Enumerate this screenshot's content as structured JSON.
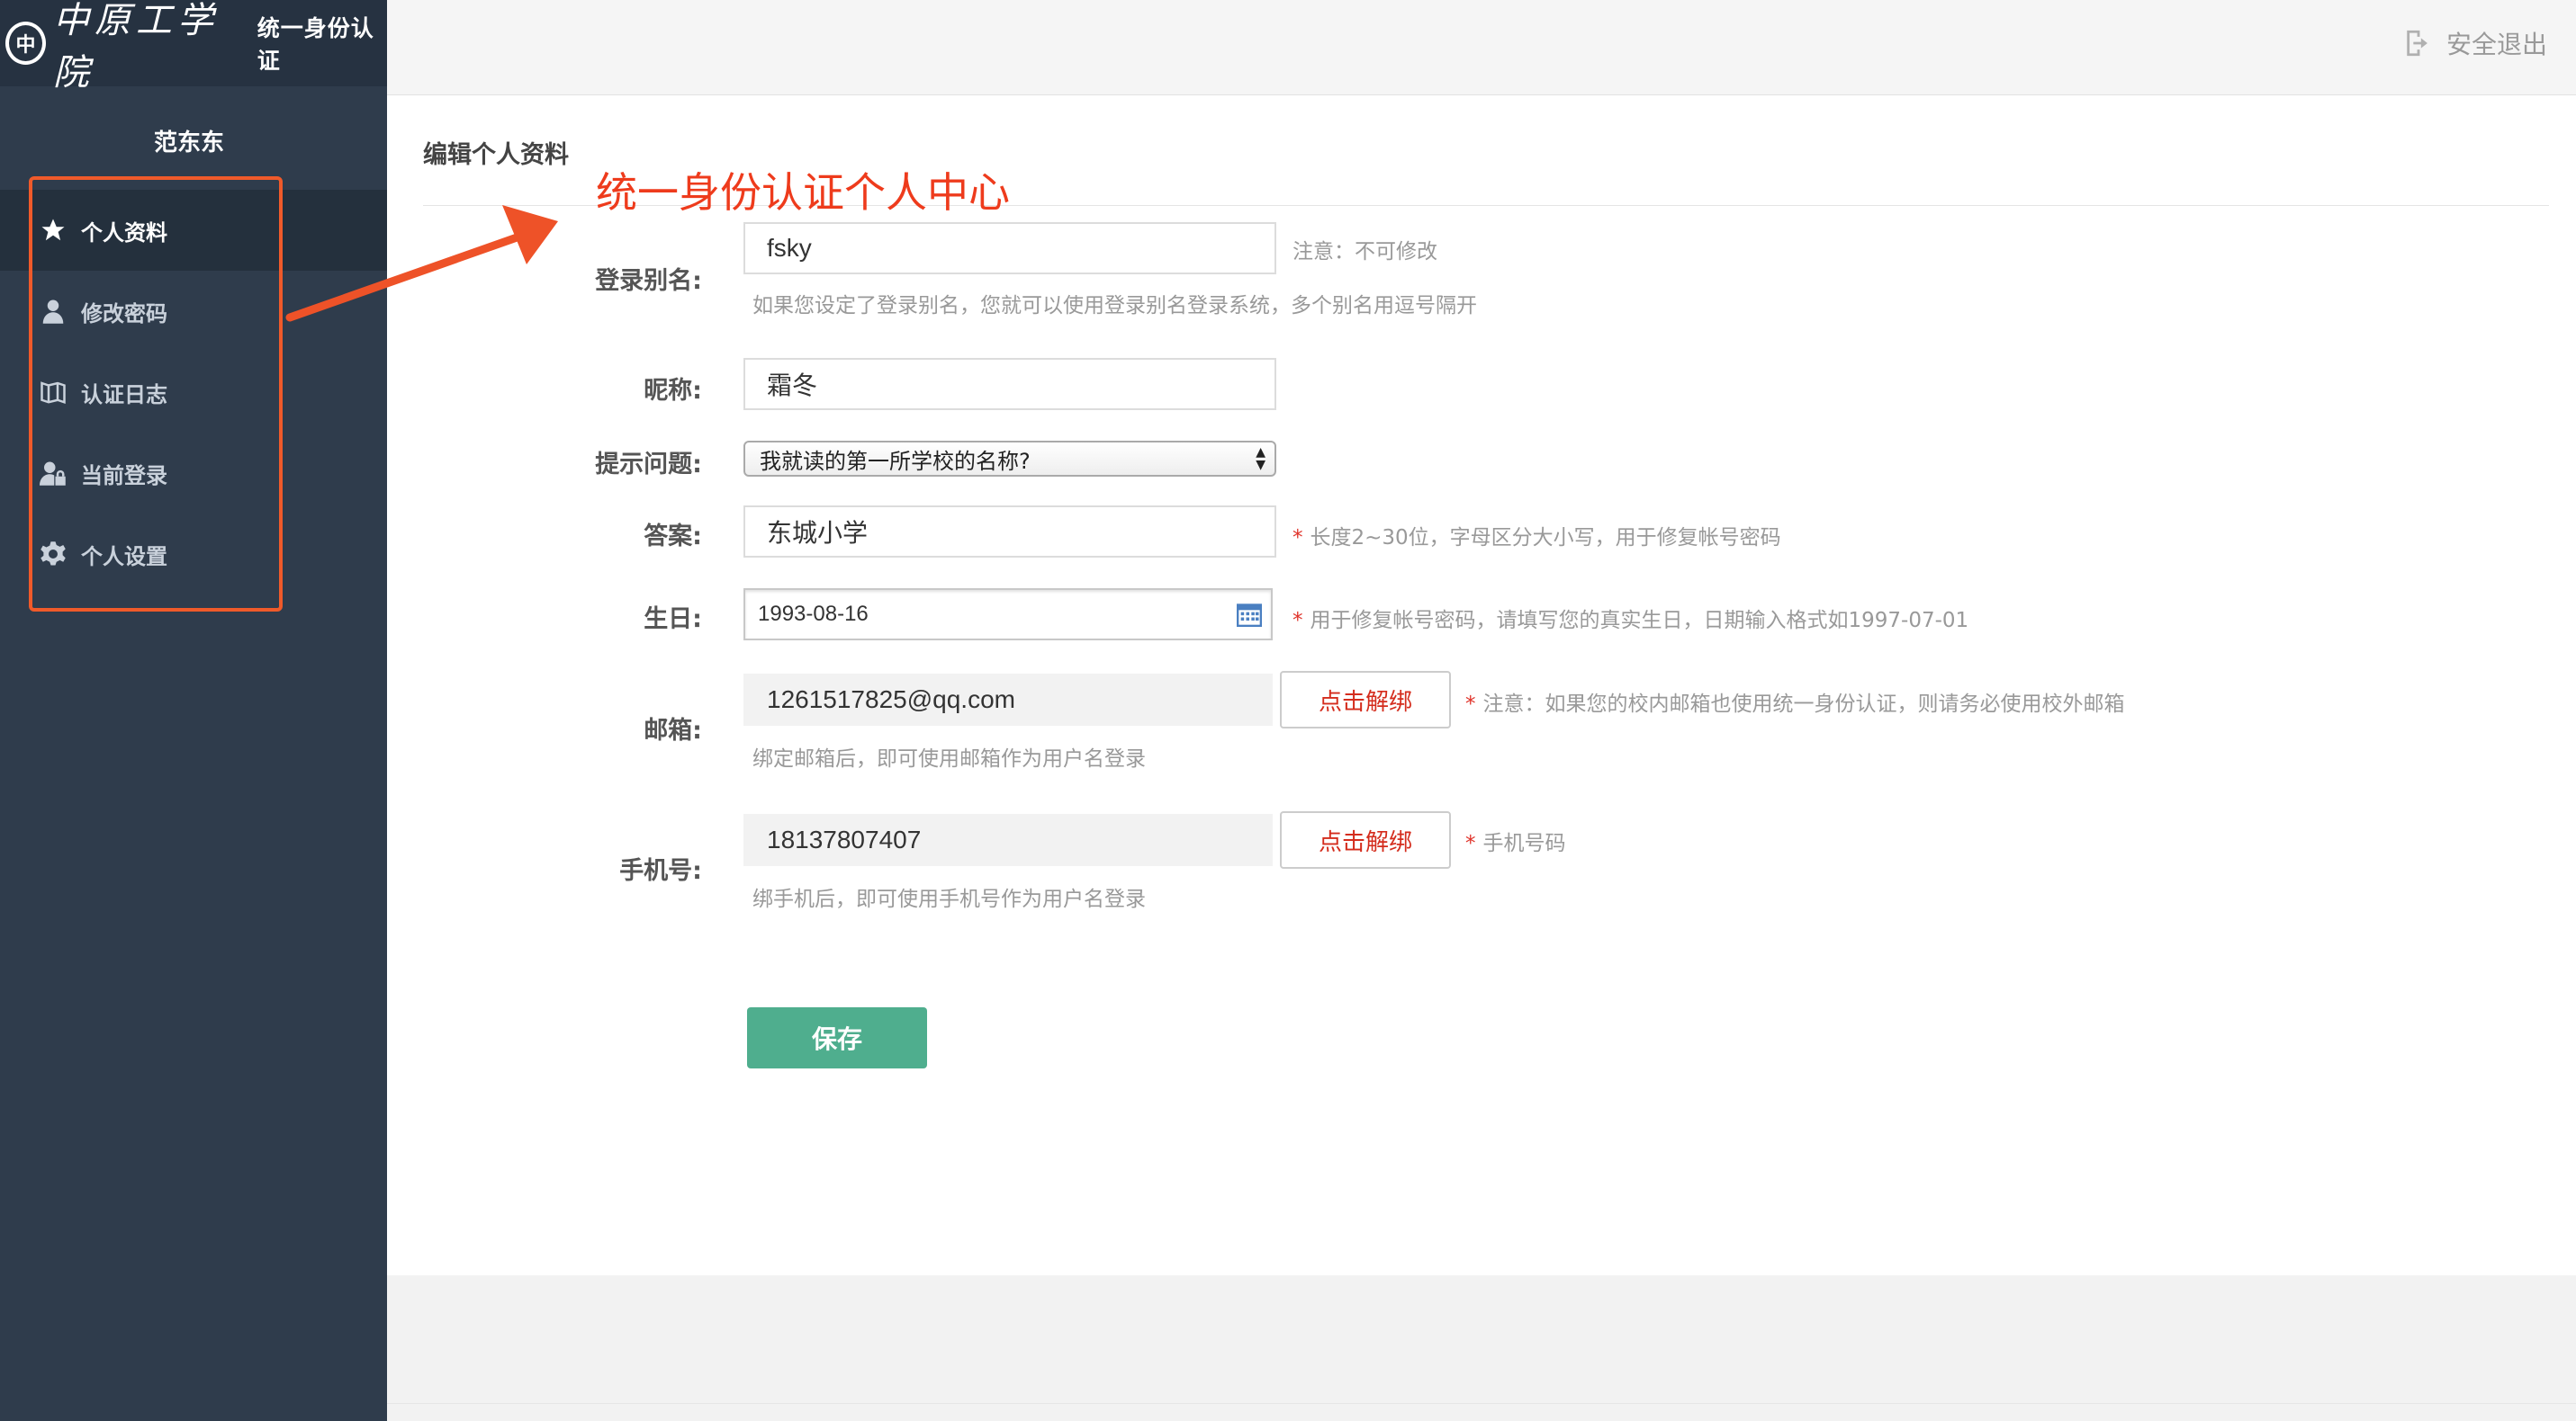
{
  "brand": {
    "logo_script": "中原工学院",
    "subtitle": "统一身份认证",
    "seal_char": "中"
  },
  "header": {
    "logout_label": "安全退出",
    "logout_icon": "logout-icon"
  },
  "sidebar": {
    "user_name": "范东东",
    "items": [
      {
        "label": "个人资料",
        "icon": "star-icon",
        "active": true
      },
      {
        "label": "修改密码",
        "icon": "user-icon",
        "active": false
      },
      {
        "label": "认证日志",
        "icon": "book-icon",
        "active": false
      },
      {
        "label": "当前登录",
        "icon": "user-lock-icon",
        "active": false
      },
      {
        "label": "个人设置",
        "icon": "gear-icon",
        "active": false
      }
    ]
  },
  "main": {
    "section_title": "编辑个人资料",
    "annotation": "统一身份认证个人中心",
    "form": {
      "alias": {
        "label": "登录别名:",
        "value": "fsky",
        "note": "注意：不可修改",
        "help": "如果您设定了登录别名，您就可以使用登录别名登录系统，多个别名用逗号隔开"
      },
      "nickname": {
        "label": "昵称:",
        "value": "霜冬"
      },
      "question": {
        "label": "提示问题:",
        "value": "我就读的第一所学校的名称?"
      },
      "answer": {
        "label": "答案:",
        "value": "东城小学",
        "note": "长度2~30位，字母区分大小写，用于修复帐号密码"
      },
      "birthday": {
        "label": "生日:",
        "value": "1993-08-16",
        "note": "用于修复帐号密码，请填写您的真实生日，日期输入格式如1997-07-01"
      },
      "email": {
        "label": "邮箱:",
        "value": "1261517825@qq.com",
        "button": "点击解绑",
        "note": "注意：如果您的校内邮箱也使用统一身份认证，则请务必使用校外邮箱",
        "help": "绑定邮箱后，即可使用邮箱作为用户名登录"
      },
      "phone": {
        "label": "手机号:",
        "value": "18137807407",
        "button": "点击解绑",
        "note": "手机号码",
        "help": "绑手机后，即可使用手机号作为用户名登录"
      },
      "save_label": "保存",
      "required_mark": "*"
    }
  },
  "colors": {
    "sidebar_bg": "#2f3c4c",
    "annotation_red": "#ee3b1c",
    "save_green": "#4fae8e",
    "unbind_red": "#d42c1c"
  }
}
